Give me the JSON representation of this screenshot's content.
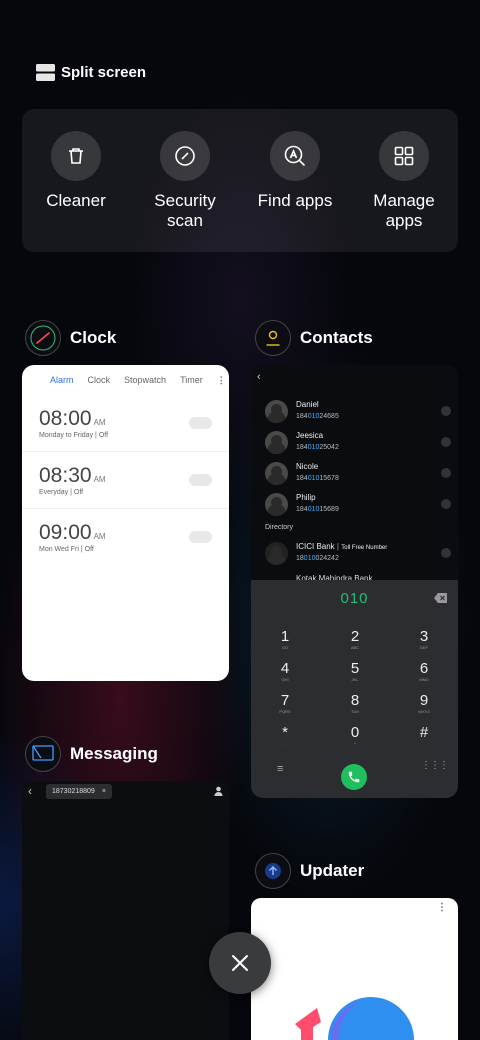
{
  "split_screen": {
    "label": "Split screen",
    "icon": "split-screen-icon"
  },
  "quick_actions": [
    {
      "label": "Cleaner",
      "icon": "trash-icon"
    },
    {
      "label": "Security scan",
      "label_line1": "Security",
      "label_line2": "scan",
      "icon": "security-scan-icon"
    },
    {
      "label": "Find apps",
      "icon": "find-apps-icon"
    },
    {
      "label": "Manage apps",
      "label_line1": "Manage",
      "label_line2": "apps",
      "icon": "grid-icon"
    }
  ],
  "clock": {
    "app_name": "Clock",
    "tabs": [
      "Alarm",
      "Clock",
      "Stopwatch",
      "Timer"
    ],
    "active_tab": "Alarm",
    "alarms": [
      {
        "time": "08:00",
        "ampm": "AM",
        "repeat": "Monday to Friday",
        "status": "Off"
      },
      {
        "time": "08:30",
        "ampm": "AM",
        "repeat": "Everyday",
        "status": "Off"
      },
      {
        "time": "09:00",
        "ampm": "AM",
        "repeat": "Mon Wed Fri",
        "status": "Off"
      }
    ]
  },
  "contacts": {
    "app_name": "Contacts",
    "list": [
      {
        "name": "Daniel",
        "num_pre": "184",
        "num_hl": "010",
        "num_post": "24685"
      },
      {
        "name": "Jeesica",
        "num_pre": "184",
        "num_hl": "010",
        "num_post": "25042"
      },
      {
        "name": "Nicole",
        "num_pre": "184",
        "num_hl": "010",
        "num_post": "15678"
      },
      {
        "name": "Philip",
        "num_pre": "184",
        "num_hl": "010",
        "num_post": "15689"
      }
    ],
    "directory_label": "Directory",
    "directory_entry": {
      "name": "ICICI Bank",
      "tag": "Toll Free Number",
      "num_pre": "18",
      "num_hl": "010",
      "num_post": "024242"
    },
    "partial_entry": "Kotak Mahindra Bank",
    "dialed": "010",
    "keypad": [
      {
        "d": "1",
        "l": "GO"
      },
      {
        "d": "2",
        "l": "ABC"
      },
      {
        "d": "3",
        "l": "DEF"
      },
      {
        "d": "4",
        "l": "GHI"
      },
      {
        "d": "5",
        "l": "JKL"
      },
      {
        "d": "6",
        "l": "MNO"
      },
      {
        "d": "7",
        "l": "PQRS"
      },
      {
        "d": "8",
        "l": "TUV"
      },
      {
        "d": "9",
        "l": "WXYZ"
      },
      {
        "d": "*",
        "l": ","
      },
      {
        "d": "0",
        "l": "+"
      },
      {
        "d": "#",
        "l": ""
      }
    ]
  },
  "messaging": {
    "app_name": "Messaging",
    "chip_number": "18730218809",
    "chip_close": "×"
  },
  "updater": {
    "app_name": "Updater"
  },
  "close_button": {
    "icon": "close-icon"
  },
  "colors": {
    "accent_blue": "#2f6fe0",
    "dial_green": "#20c070",
    "highlight_blue": "#3fb0ff"
  }
}
